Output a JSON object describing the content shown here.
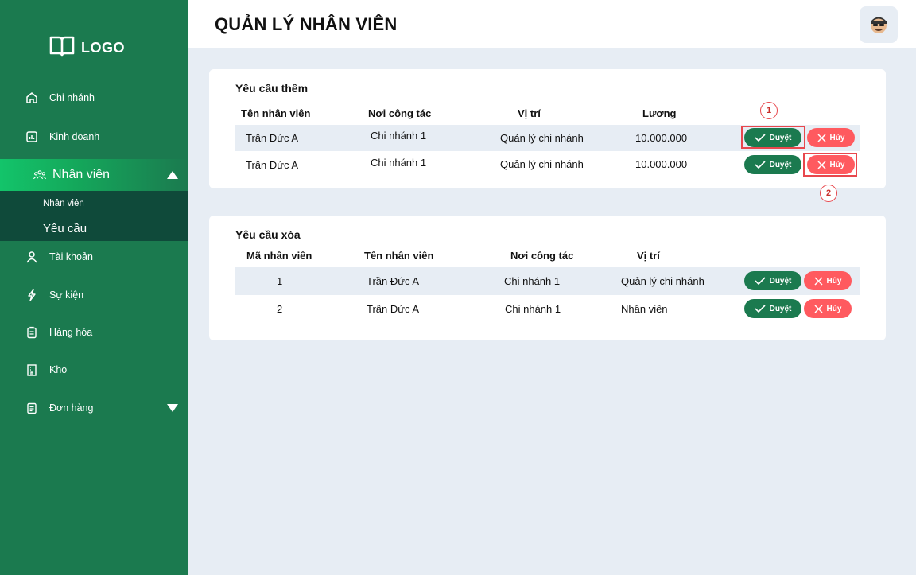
{
  "sidebar": {
    "logo": "LOGO",
    "items": [
      {
        "label": "Chi nhánh",
        "icon": "home-icon"
      },
      {
        "label": "Kinh doanh",
        "icon": "chart-icon"
      },
      {
        "label": "Nhân viên",
        "icon": "users-icon",
        "active": true
      },
      {
        "label": "Tài khoản",
        "icon": "user-account-icon"
      },
      {
        "label": "Sự kiện",
        "icon": "lightning-icon"
      },
      {
        "label": "Hàng hóa",
        "icon": "clipboard-icon"
      },
      {
        "label": "Kho",
        "icon": "building-icon"
      },
      {
        "label": "Đơn hàng",
        "icon": "list-icon"
      }
    ],
    "submenu": [
      "Nhân viên",
      "Yêu cầu"
    ]
  },
  "header": {
    "title": "QUẢN LÝ NHÂN VIÊN"
  },
  "add_requests": {
    "title": "Yêu cầu thêm",
    "columns": [
      "Tên nhân viên",
      "Nơi công tác",
      "Vị trí",
      "Lương"
    ],
    "rows": [
      {
        "name": "Trần Đức A",
        "branch": "Chi nhánh 1",
        "position": "Quản lý chi nhánh",
        "salary": "10.000.000"
      },
      {
        "name": "Trần Đức A",
        "branch": "Chi nhánh 1",
        "position": "Quản lý chi nhánh",
        "salary": "10.000.000"
      }
    ]
  },
  "delete_requests": {
    "title": "Yêu cầu xóa",
    "columns": [
      "Mã nhân viên",
      "Tên nhân viên",
      "Nơi công tác",
      "Vị trí"
    ],
    "rows": [
      {
        "id": "1",
        "name": "Trần Đức A",
        "branch": "Chi nhánh 1",
        "position": "Quản lý chi nhánh"
      },
      {
        "id": "2",
        "name": "Trần Đức A",
        "branch": "Chi nhánh 1",
        "position": "Nhân viên"
      }
    ]
  },
  "buttons": {
    "approve": "Duyệt",
    "reject": "Hủy"
  },
  "markers": [
    "1",
    "2"
  ],
  "colors": {
    "sidebar": "#1b7a4f",
    "approve": "#1b7a4f",
    "reject": "#ff5a5f",
    "highlight": "#e8474d",
    "background": "#e7edf4"
  }
}
